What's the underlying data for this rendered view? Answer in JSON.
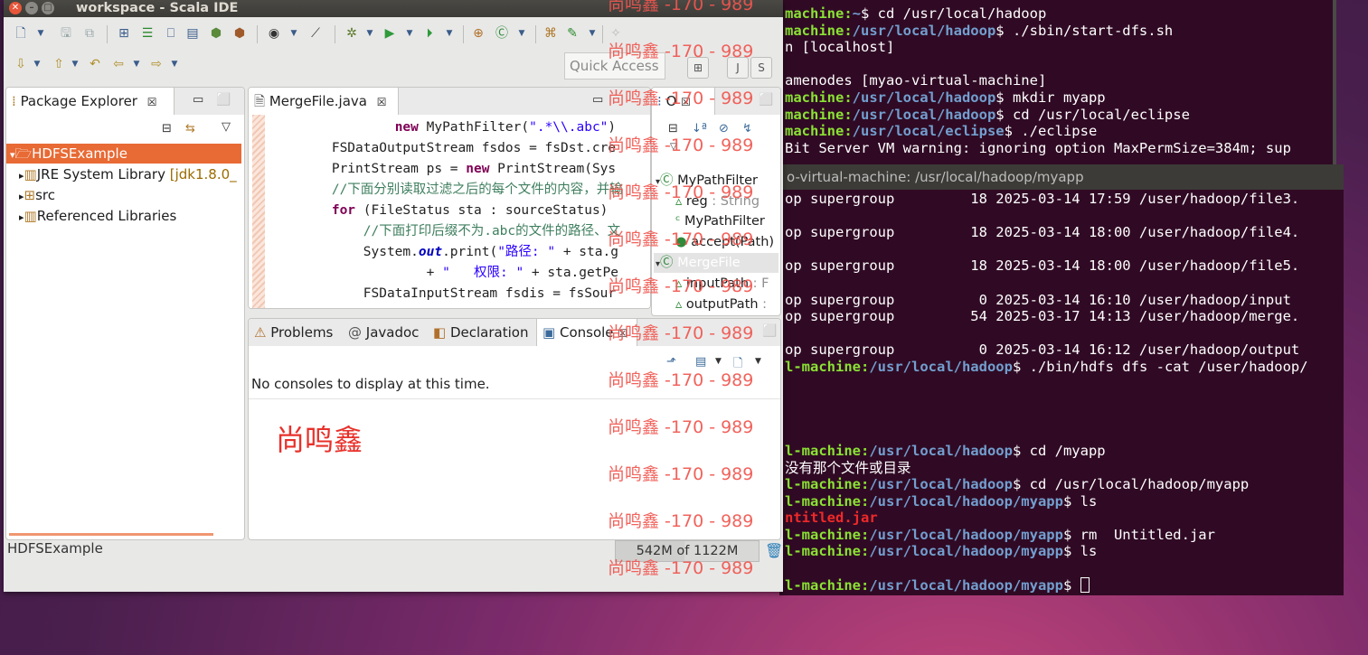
{
  "terminal_back": {
    "lines": [
      [
        {
          "t": "machine:",
          "c": "tg"
        },
        {
          "t": "~",
          "c": "tb"
        },
        {
          "t": "$ cd /usr/local/hadoop",
          "c": ""
        }
      ],
      [
        {
          "t": "machine:",
          "c": "tg"
        },
        {
          "t": "/usr/local/hadoop",
          "c": "tb"
        },
        {
          "t": "$ ./sbin/start-dfs.sh",
          "c": ""
        }
      ],
      [
        {
          "t": "n [localhost]",
          "c": ""
        }
      ],
      [
        {
          "t": "",
          "c": ""
        }
      ],
      [
        {
          "t": "amenodes [myao-virtual-machine]",
          "c": ""
        }
      ],
      [
        {
          "t": "machine:",
          "c": "tg"
        },
        {
          "t": "/usr/local/hadoop",
          "c": "tb"
        },
        {
          "t": "$ mkdir myapp",
          "c": ""
        }
      ],
      [
        {
          "t": "machine:",
          "c": "tg"
        },
        {
          "t": "/usr/local/hadoop",
          "c": "tb"
        },
        {
          "t": "$ cd /usr/local/eclipse",
          "c": ""
        }
      ],
      [
        {
          "t": "machine:",
          "c": "tg"
        },
        {
          "t": "/usr/local/eclipse",
          "c": "tb"
        },
        {
          "t": "$ ./eclipse",
          "c": ""
        }
      ],
      [
        {
          "t": "Bit Server VM warning: ignoring option MaxPermSize=384m; sup",
          "c": ""
        }
      ]
    ]
  },
  "terminal_front": {
    "title": "o-virtual-machine: /usr/local/hadoop/myapp",
    "lines": [
      [
        {
          "t": "op supergroup         18 2025-03-14 17:59 /user/hadoop/file3.",
          "c": ""
        }
      ],
      [
        {
          "t": "",
          "c": ""
        }
      ],
      [
        {
          "t": "op supergroup         18 2025-03-14 18:00 /user/hadoop/file4.",
          "c": ""
        }
      ],
      [
        {
          "t": "",
          "c": ""
        }
      ],
      [
        {
          "t": "op supergroup         18 2025-03-14 18:00 /user/hadoop/file5.",
          "c": ""
        }
      ],
      [
        {
          "t": "",
          "c": ""
        }
      ],
      [
        {
          "t": "op supergroup          0 2025-03-14 16:10 /user/hadoop/input",
          "c": ""
        }
      ],
      [
        {
          "t": "op supergroup         54 2025-03-17 14:13 /user/hadoop/merge.",
          "c": ""
        }
      ],
      [
        {
          "t": "",
          "c": ""
        }
      ],
      [
        {
          "t": "op supergroup          0 2025-03-14 16:12 /user/hadoop/output",
          "c": ""
        }
      ],
      [
        {
          "t": "l-machine:",
          "c": "tg"
        },
        {
          "t": "/usr/local/hadoop",
          "c": "tb"
        },
        {
          "t": "$ ./bin/hdfs dfs -cat /user/hadoop/",
          "c": ""
        }
      ],
      [
        {
          "t": "",
          "c": ""
        }
      ],
      [
        {
          "t": "",
          "c": ""
        }
      ],
      [
        {
          "t": "",
          "c": ""
        }
      ],
      [
        {
          "t": "",
          "c": ""
        }
      ],
      [
        {
          "t": "l-machine:",
          "c": "tg"
        },
        {
          "t": "/usr/local/hadoop",
          "c": "tb"
        },
        {
          "t": "$ cd /myapp",
          "c": ""
        }
      ],
      [
        {
          "t": "没有那个文件或目录",
          "c": ""
        }
      ],
      [
        {
          "t": "l-machine:",
          "c": "tg"
        },
        {
          "t": "/usr/local/hadoop",
          "c": "tb"
        },
        {
          "t": "$ cd /usr/local/hadoop/myapp",
          "c": ""
        }
      ],
      [
        {
          "t": "l-machine:",
          "c": "tg"
        },
        {
          "t": "/usr/local/hadoop/myapp",
          "c": "tb"
        },
        {
          "t": "$ ls",
          "c": ""
        }
      ],
      [
        {
          "t": "ntitled.jar",
          "c": "tr"
        }
      ],
      [
        {
          "t": "l-machine:",
          "c": "tg"
        },
        {
          "t": "/usr/local/hadoop/myapp",
          "c": "tb"
        },
        {
          "t": "$ rm  Untitled.jar",
          "c": ""
        }
      ],
      [
        {
          "t": "l-machine:",
          "c": "tg"
        },
        {
          "t": "/usr/local/hadoop/myapp",
          "c": "tb"
        },
        {
          "t": "$ ls",
          "c": ""
        }
      ],
      [
        {
          "t": "",
          "c": ""
        }
      ],
      [
        {
          "t": "l-machine:",
          "c": "tg"
        },
        {
          "t": "/usr/local/hadoop/myapp",
          "c": "tb"
        },
        {
          "t": "$ ",
          "c": ""
        }
      ]
    ]
  },
  "eclipse": {
    "window_title": "workspace - Scala IDE",
    "quick_access": "Quick Access",
    "package_explorer": {
      "tab": "Package Explorer",
      "items": [
        {
          "label": "HDFSExample",
          "selected": true
        },
        {
          "label": "JRE System Library",
          "extra": "[jdk1.8.0_"
        },
        {
          "label": "src"
        },
        {
          "label": "Referenced Libraries"
        }
      ]
    },
    "editor": {
      "tab": "MergeFile.java",
      "lines": [
        [
          {
            "t": "                new MyPathFilter(\".*\\\\.abc\")",
            "c": "mix1"
          }
        ],
        [
          {
            "t": "        FSDataOutputStream fsdos = fsDst.cre",
            "c": ""
          }
        ],
        [
          {
            "t": "        PrintStream ps = ",
            "c": ""
          },
          {
            "t": "new",
            "c": "kw"
          },
          {
            "t": " PrintStream(Sys",
            "c": ""
          }
        ],
        [
          {
            "t": "        //下面分别读取过滤之后的每个文件的内容，并输",
            "c": "cm"
          }
        ],
        [
          {
            "t": "        ",
            "c": ""
          },
          {
            "t": "for",
            "c": "kw"
          },
          {
            "t": " (FileStatus sta : sourceStatus)",
            "c": ""
          }
        ],
        [
          {
            "t": "            //下面打印后缀不为.abc的文件的路径、文",
            "c": "cm"
          }
        ],
        [
          {
            "t": "            System.",
            "c": ""
          },
          {
            "t": "out",
            "c": "fld"
          },
          {
            "t": ".print(",
            "c": ""
          },
          {
            "t": "\"路径: \"",
            "c": "str"
          },
          {
            "t": " + sta.g",
            "c": ""
          }
        ],
        [
          {
            "t": "                    + ",
            "c": ""
          },
          {
            "t": "\"   权限: \"",
            "c": "str"
          },
          {
            "t": " + sta.getPe",
            "c": ""
          }
        ],
        [
          {
            "t": "            FSDataInputStream fsdis = fsSour",
            "c": ""
          }
        ]
      ]
    },
    "outline": {
      "tab": "O",
      "items": [
        {
          "label": "MyPathFilter",
          "suffix": ""
        },
        {
          "label": "reg",
          "suffix": " : String"
        },
        {
          "label": "MyPathFilter",
          "suffix": ""
        },
        {
          "label": "accept(Path)",
          "suffix": ""
        },
        {
          "label": "MergeFile",
          "suffix": ""
        },
        {
          "label": "inputPath",
          "suffix": " : F"
        },
        {
          "label": "outputPath",
          "suffix": " :"
        }
      ]
    },
    "bottom_tabs": [
      "Problems",
      "Javadoc",
      "Declaration",
      "Console"
    ],
    "console_message": "No consoles to display at this time.",
    "status_left": "HDFSExample",
    "heap": {
      "label": "542M of 1122M",
      "used_fraction": 0.48
    }
  },
  "overlay": {
    "name": "尚鸣鑫",
    "watermark": "尚鸣鑫 -170 - 989",
    "watermark_count": 13
  }
}
